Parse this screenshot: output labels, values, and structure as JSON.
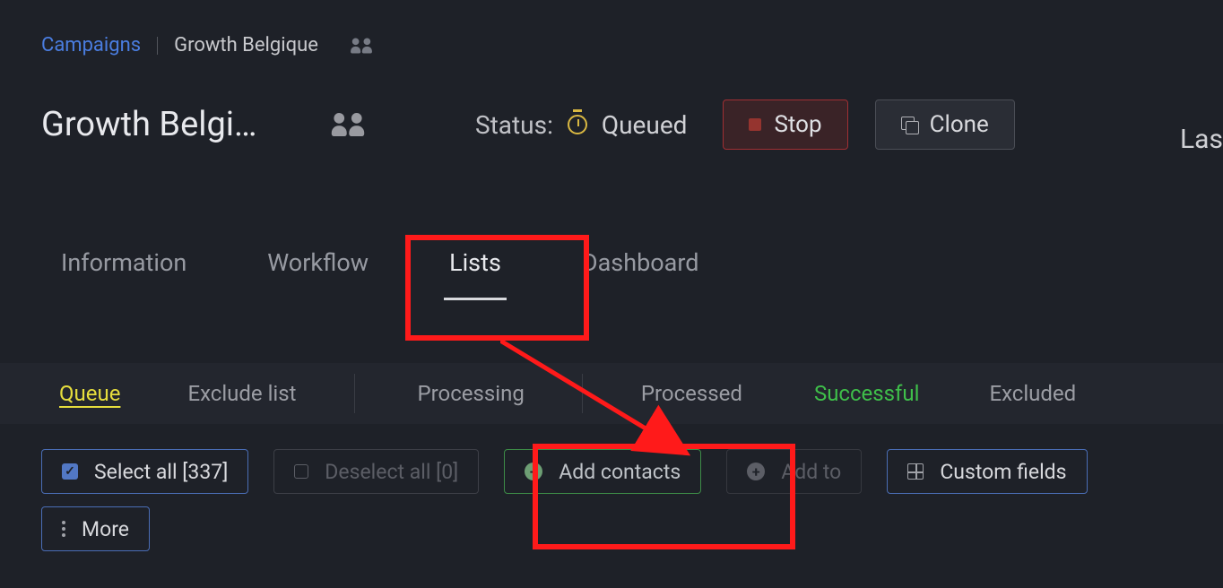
{
  "breadcrumb": {
    "root": "Campaigns",
    "current": "Growth Belgique"
  },
  "header": {
    "title": "Growth Belgi…",
    "status_label": "Status:",
    "status_value": "Queued",
    "stop": "Stop",
    "clone": "Clone",
    "last": "Last"
  },
  "tabs": {
    "information": "Information",
    "workflow": "Workflow",
    "lists": "Lists",
    "dashboard": "Dashboard"
  },
  "subtabs": {
    "queue": "Queue",
    "exclude_list": "Exclude list",
    "processing": "Processing",
    "processed": "Processed",
    "successful": "Successful",
    "excluded": "Excluded"
  },
  "actions": {
    "select_all": "Select all [337]",
    "deselect_all": "Deselect all [0]",
    "add_contacts": "Add contacts",
    "add_to": "Add to",
    "custom_fields": "Custom fields",
    "more": "More"
  }
}
